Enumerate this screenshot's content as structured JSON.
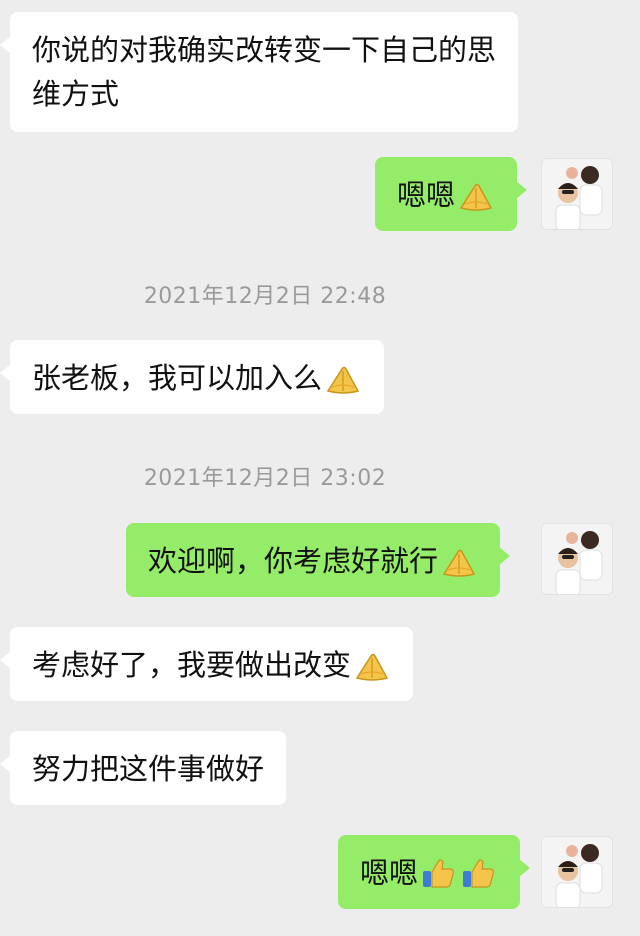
{
  "conversation": {
    "messages": [
      {
        "side": "in",
        "text": "你说的对我确实改转变一下自己的思维方式",
        "emojis": []
      },
      {
        "side": "out",
        "text": "嗯嗯",
        "emojis": [
          "palms-together-emoji"
        ]
      },
      {
        "type": "timestamp",
        "text": "2021年12月2日 22:48"
      },
      {
        "side": "in",
        "text": "张老板，我可以加入么",
        "emojis": [
          "palms-together-emoji"
        ]
      },
      {
        "type": "timestamp",
        "text": "2021年12月2日 23:02"
      },
      {
        "side": "out",
        "text": "欢迎啊，你考虑好就行",
        "emojis": [
          "palms-together-emoji"
        ]
      },
      {
        "side": "in",
        "text": "考虑好了，我要做出改变",
        "emojis": [
          "palms-together-emoji"
        ]
      },
      {
        "side": "in",
        "text": "努力把这件事做好",
        "emojis": []
      },
      {
        "side": "out",
        "text": "嗯嗯",
        "emojis": [
          "thumbs-up-emoji",
          "thumbs-up-emoji"
        ]
      }
    ]
  },
  "colors": {
    "background": "#ededed",
    "incoming_bubble": "#ffffff",
    "outgoing_bubble": "#95ec69",
    "timestamp_text": "#9a9a9a"
  }
}
